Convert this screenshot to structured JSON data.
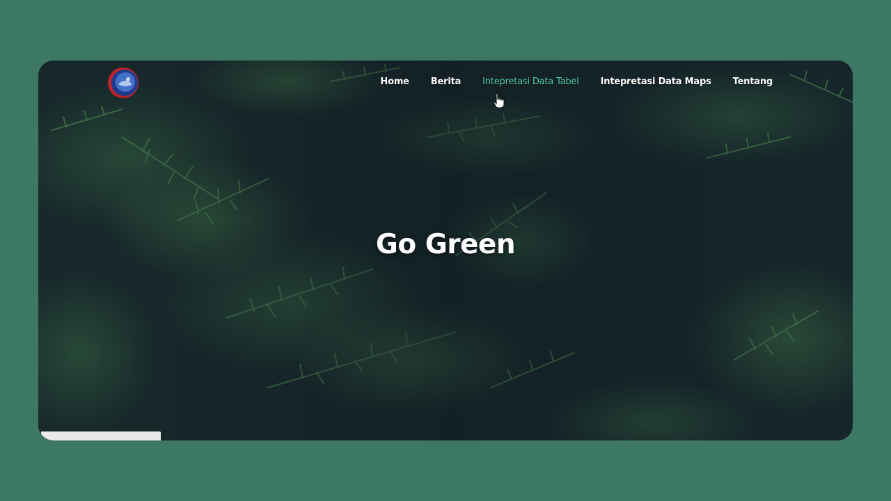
{
  "header": {
    "logo_icon": "globe-logo-icon",
    "nav": [
      {
        "label": "Home",
        "active": false
      },
      {
        "label": "Berita",
        "active": false
      },
      {
        "label": "Intepretasi Data Tabel",
        "active": true
      },
      {
        "label": "Intepretasi Data Maps",
        "active": false
      },
      {
        "label": "Tentang",
        "active": false
      }
    ]
  },
  "hero": {
    "title": "Go Green",
    "background": "dark-pine-branches"
  },
  "cursor": {
    "icon": "hand-pointer-icon"
  },
  "colors": {
    "page_background": "#3c7863",
    "hero_background": "#152326",
    "nav_active": "#4fd1a4",
    "nav_text": "#ffffff"
  }
}
